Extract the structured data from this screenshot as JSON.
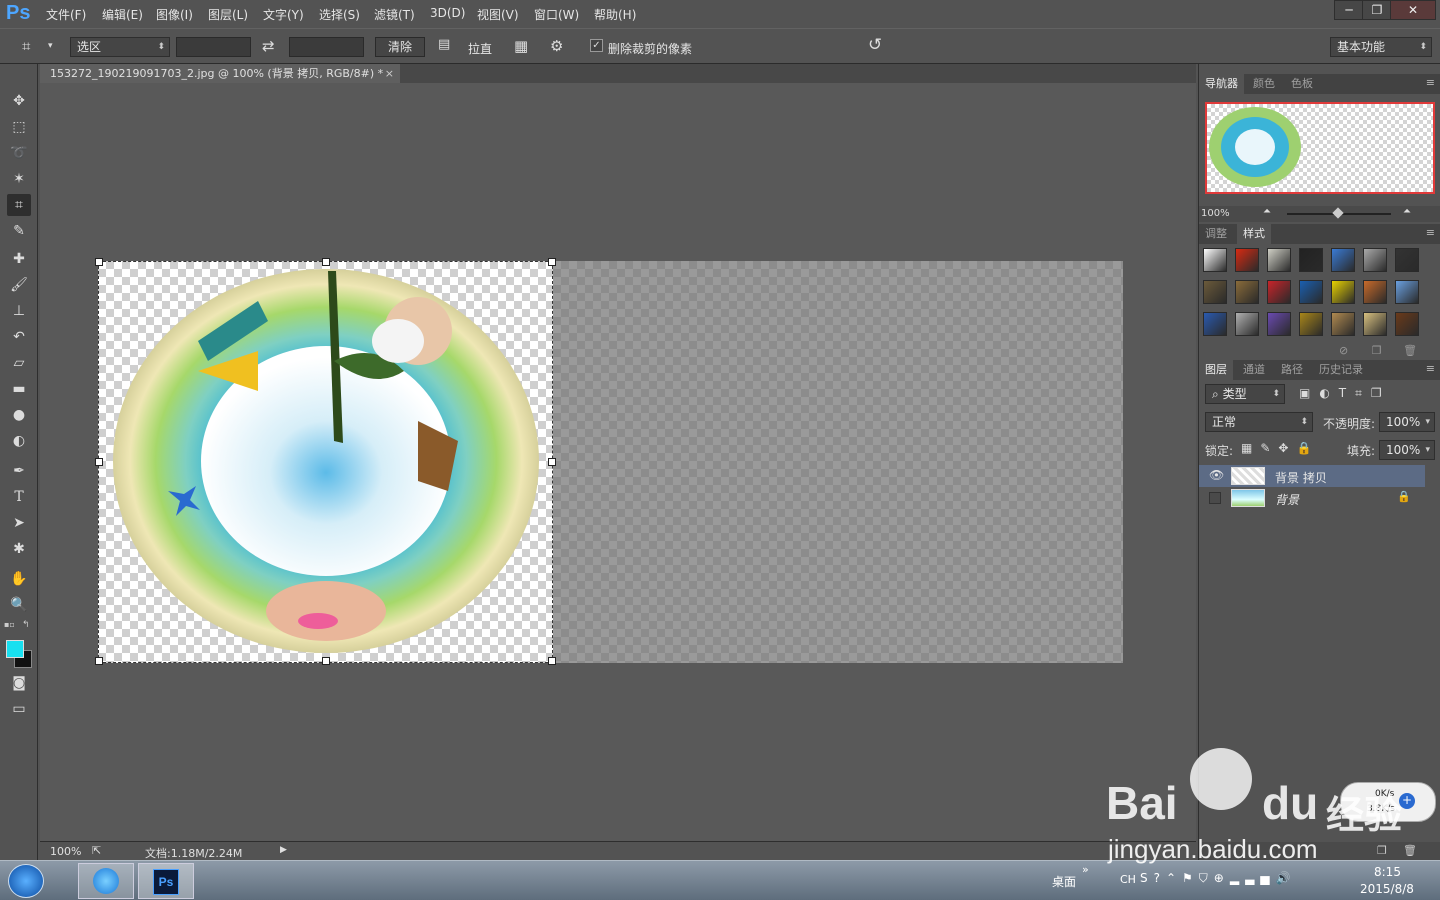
{
  "app": {
    "logo": "Ps"
  },
  "menu": [
    "文件(F)",
    "编辑(E)",
    "图像(I)",
    "图层(L)",
    "文字(Y)",
    "选择(S)",
    "滤镜(T)",
    "3D(D)",
    "视图(V)",
    "窗口(W)",
    "帮助(H)"
  ],
  "window_buttons": {
    "minimize": "─",
    "restore": "❐",
    "close": "✕"
  },
  "options": {
    "ratio_select": "选区",
    "clear_button": "清除",
    "straighten_label": "拉直",
    "delete_cropped_label": "删除裁剪的像素",
    "delete_cropped_checked": true,
    "workspace": "基本功能"
  },
  "document_tab": {
    "title": "153272_190219091703_2.jpg @ 100% (背景 拷贝, RGB/8#) *",
    "close": "×"
  },
  "status": {
    "zoom": "100%",
    "doc_info": "文档:1.18M/2.24M"
  },
  "navigator": {
    "tabs": [
      "导航器",
      "颜色",
      "色板"
    ],
    "zoom": "100%"
  },
  "styles_panel": {
    "tabs": [
      "调整",
      "样式"
    ],
    "swatch_colors": [
      "#ffffff",
      "#d82a12",
      "#cfcfc5",
      "#222222",
      "#3a7bd5",
      "#aaaaaa",
      "#333333",
      "#6b5a3a",
      "#8a6b3a",
      "#c8242a",
      "#1a5fb0",
      "#e8d200",
      "#c86a2a",
      "#6aa0e0",
      "#2a5ab0",
      "#b0b0b0",
      "#6a4ab0",
      "#a8861a",
      "#b08a50",
      "#d8c080",
      "#6a3a1a"
    ]
  },
  "layers_panel": {
    "tabs": [
      "图层",
      "通道",
      "路径",
      "历史记录"
    ],
    "filter_kind": "类型",
    "blend_mode": "正常",
    "opacity_label": "不透明度:",
    "opacity_value": "100%",
    "lock_label": "锁定:",
    "fill_label": "填充:",
    "fill_value": "100%",
    "layers": [
      {
        "name": "背景 拷贝",
        "visible": true,
        "selected": true
      },
      {
        "name": "背景",
        "visible": false,
        "selected": false,
        "locked": true
      }
    ]
  },
  "taskbar": {
    "desktop_label": "桌面",
    "lang": "CH",
    "net_up": "0K/s",
    "net_down": "3.8K/s",
    "time": "8:15",
    "date": "2015/8/8"
  },
  "watermark": {
    "brand": "Bai",
    "brand2": "du",
    "brand3": "经验",
    "url": "jingyan.baidu.com"
  }
}
